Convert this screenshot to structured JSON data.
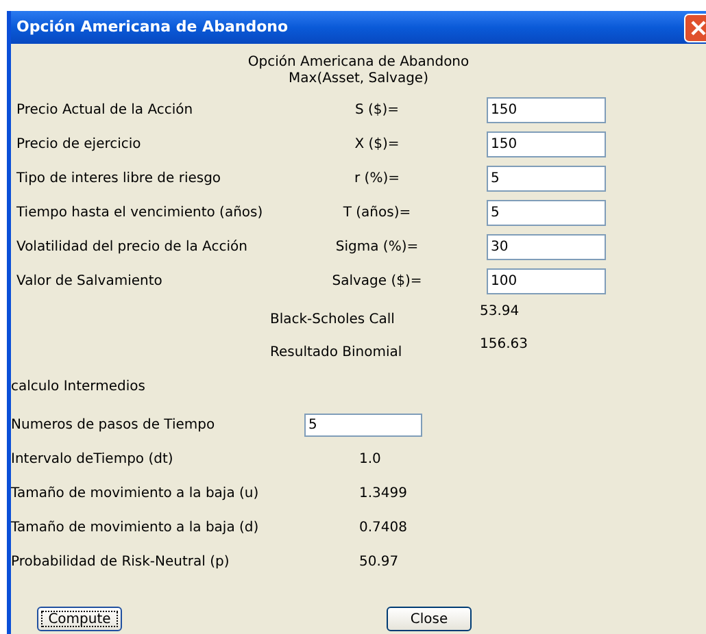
{
  "window": {
    "title": "Opción Americana de Abandono"
  },
  "heading": [
    "Opción Americana de Abandono",
    "Max(Asset, Salvage)"
  ],
  "inputs": [
    {
      "label": "Precio Actual de la Acción",
      "symbol": "S ($)=",
      "value": "150"
    },
    {
      "label": "Precio de ejercicio",
      "symbol": "X  ($)=",
      "value": "150"
    },
    {
      "label": "Tipo de interes libre de riesgo",
      "symbol": "r  (%)=",
      "value": "5"
    },
    {
      "label": "Tiempo hasta el vencimiento (años)",
      "symbol": "T (años)=",
      "value": "5"
    },
    {
      "label": "Volatilidad del precio de la Acción",
      "symbol": "Sigma  (%)=",
      "value": "30"
    },
    {
      "label": "Valor  de Salvamiento",
      "symbol": "Salvage ($)=",
      "value": "100"
    }
  ],
  "results": [
    {
      "label": "Black-Scholes Call",
      "value": "53.94"
    },
    {
      "label": "Resultado Binomial",
      "value": "156.63"
    }
  ],
  "section_label": "calculo Intermedios",
  "steps": {
    "label": "Numeros de pasos de Tiempo",
    "value": "5"
  },
  "intermediates": [
    {
      "label": "Intervalo deTiempo (dt)",
      "value": "1.0"
    },
    {
      "label": "Tamaño de movimiento a la baja (u)",
      "value": "1.3499"
    },
    {
      "label": "Tamaño de movimiento a la baja (d)",
      "value": "0.7408"
    },
    {
      "label": "Probabilidad de Risk-Neutral  (p)",
      "value": "50.97"
    }
  ],
  "buttons": [
    {
      "label": "Compute",
      "focused": true
    },
    {
      "label": "Close",
      "focused": false
    }
  ]
}
